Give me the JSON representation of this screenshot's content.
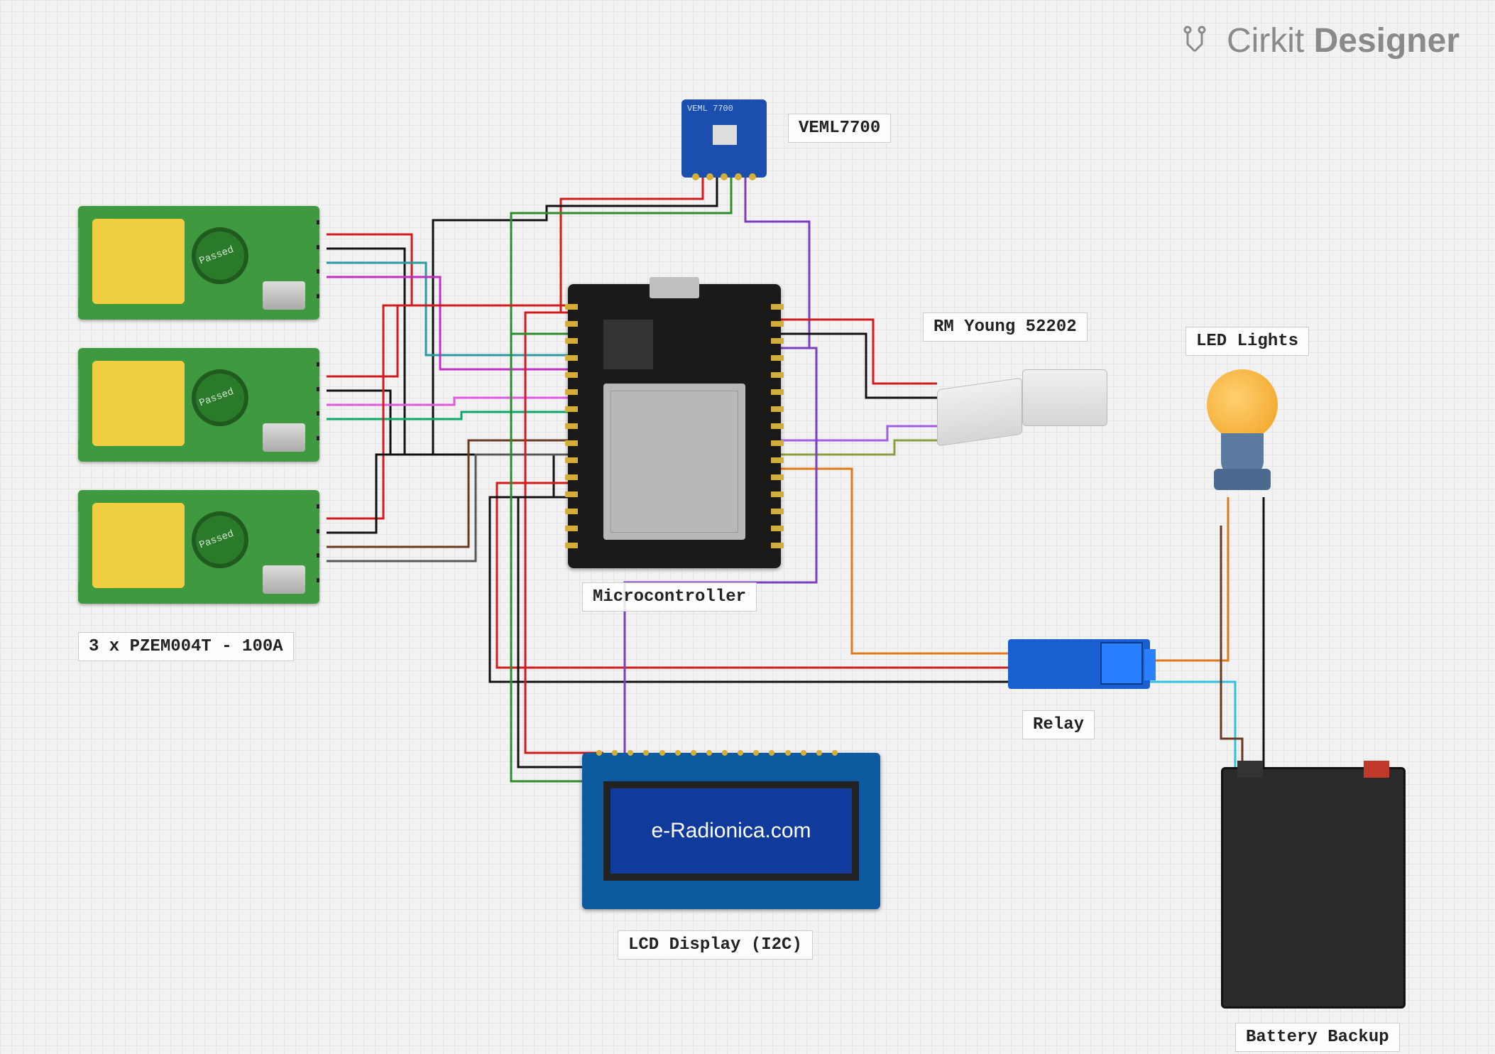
{
  "brand": {
    "name": "Cirkit",
    "suffix": "Designer"
  },
  "components": {
    "veml": {
      "label": "VEML7700",
      "board_text": "VEML 7700"
    },
    "rain": {
      "label": "RM Young 52202"
    },
    "led": {
      "label": "LED Lights"
    },
    "mcu": {
      "label": "Microcontroller"
    },
    "pzem": {
      "label": "3 x PZEM004T - 100A",
      "count": 3
    },
    "relay": {
      "label": "Relay"
    },
    "lcd": {
      "label": "LCD Display (I2C)",
      "screen_text": "e-Radionica.com"
    },
    "battery": {
      "label": "Battery Backup"
    }
  },
  "wire_colors": {
    "vcc": "#d01c1c",
    "gnd": "#111111",
    "sda": "#2e8b2e",
    "scl": "#7a3fbd",
    "tx1": "#c030c0",
    "rx1": "#2a9aa0",
    "tx2": "#e05ae0",
    "rx2": "#0aa86a",
    "tx3": "#6a3a20",
    "rx3": "#585858",
    "sig": "#e07a1a",
    "ctl": "#a060e0",
    "ctl2": "#8aa040",
    "relay_vcc": "#d01c1c",
    "relay_gnd": "#111111",
    "relay_in": "#e07a1a",
    "load_pos": "#6a3a20",
    "load_neg": "#111111",
    "batt_cycle": "#30c0e0"
  }
}
